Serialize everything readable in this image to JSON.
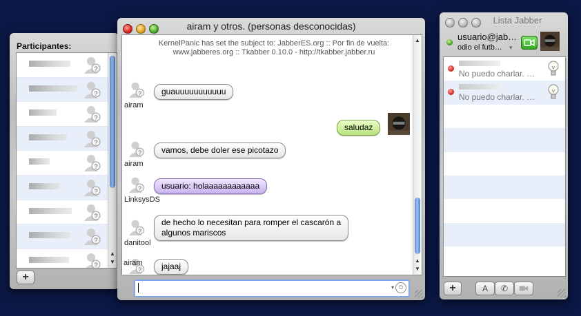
{
  "participants": {
    "title": "Participantes:",
    "row_count": 10,
    "add_label": "+"
  },
  "chat": {
    "title": "airam y otros. (personas desconocidas)",
    "subject": "KernelPanic has set the subject to: JabberES.org :: Por fin de vuelta: www.jabberes.org :: Tkabber 0.10.0 - http://tkabber.jabber.ru",
    "messages": [
      {
        "author": "airam",
        "text": "guauuuuuuuuuuu",
        "style": "normal"
      },
      {
        "author": "",
        "text": "saludaz",
        "style": "own"
      },
      {
        "author": "airam",
        "text": "vamos, debe doler ese picotazo",
        "style": "normal"
      },
      {
        "author": "LinksysDS",
        "text": "usuario: holaaaaaaaaaaaa",
        "style": "highlight"
      },
      {
        "author": "danitool",
        "text_line1": "de hecho lo necesitan para romper el cascarón a",
        "text_line2": "algunos mariscos",
        "style": "normal"
      },
      {
        "author": "airam",
        "text": "jajaaj",
        "style": "normal"
      }
    ],
    "input_value": ""
  },
  "roster": {
    "title": "Lista Jabber",
    "account": "usuario@jab…",
    "status": "odio el futb…",
    "contacts": [
      {
        "status": "No puedo charlar. …"
      },
      {
        "status": "No puedo charlar. …"
      }
    ],
    "add_label": "+",
    "text_button": "A"
  },
  "colors": {
    "desktop": "#0b1845",
    "own_bubble": "#b9e07c",
    "highlight_bubble": "#c9b2ef",
    "offline_dot": "#d3281f",
    "online_dot": "#3b9c1a"
  },
  "icons": [
    "unknown-buddy-icon",
    "user-avatar-icon",
    "smiley-icon",
    "lightbulb-icon",
    "video-camera-icon",
    "phone-icon"
  ]
}
